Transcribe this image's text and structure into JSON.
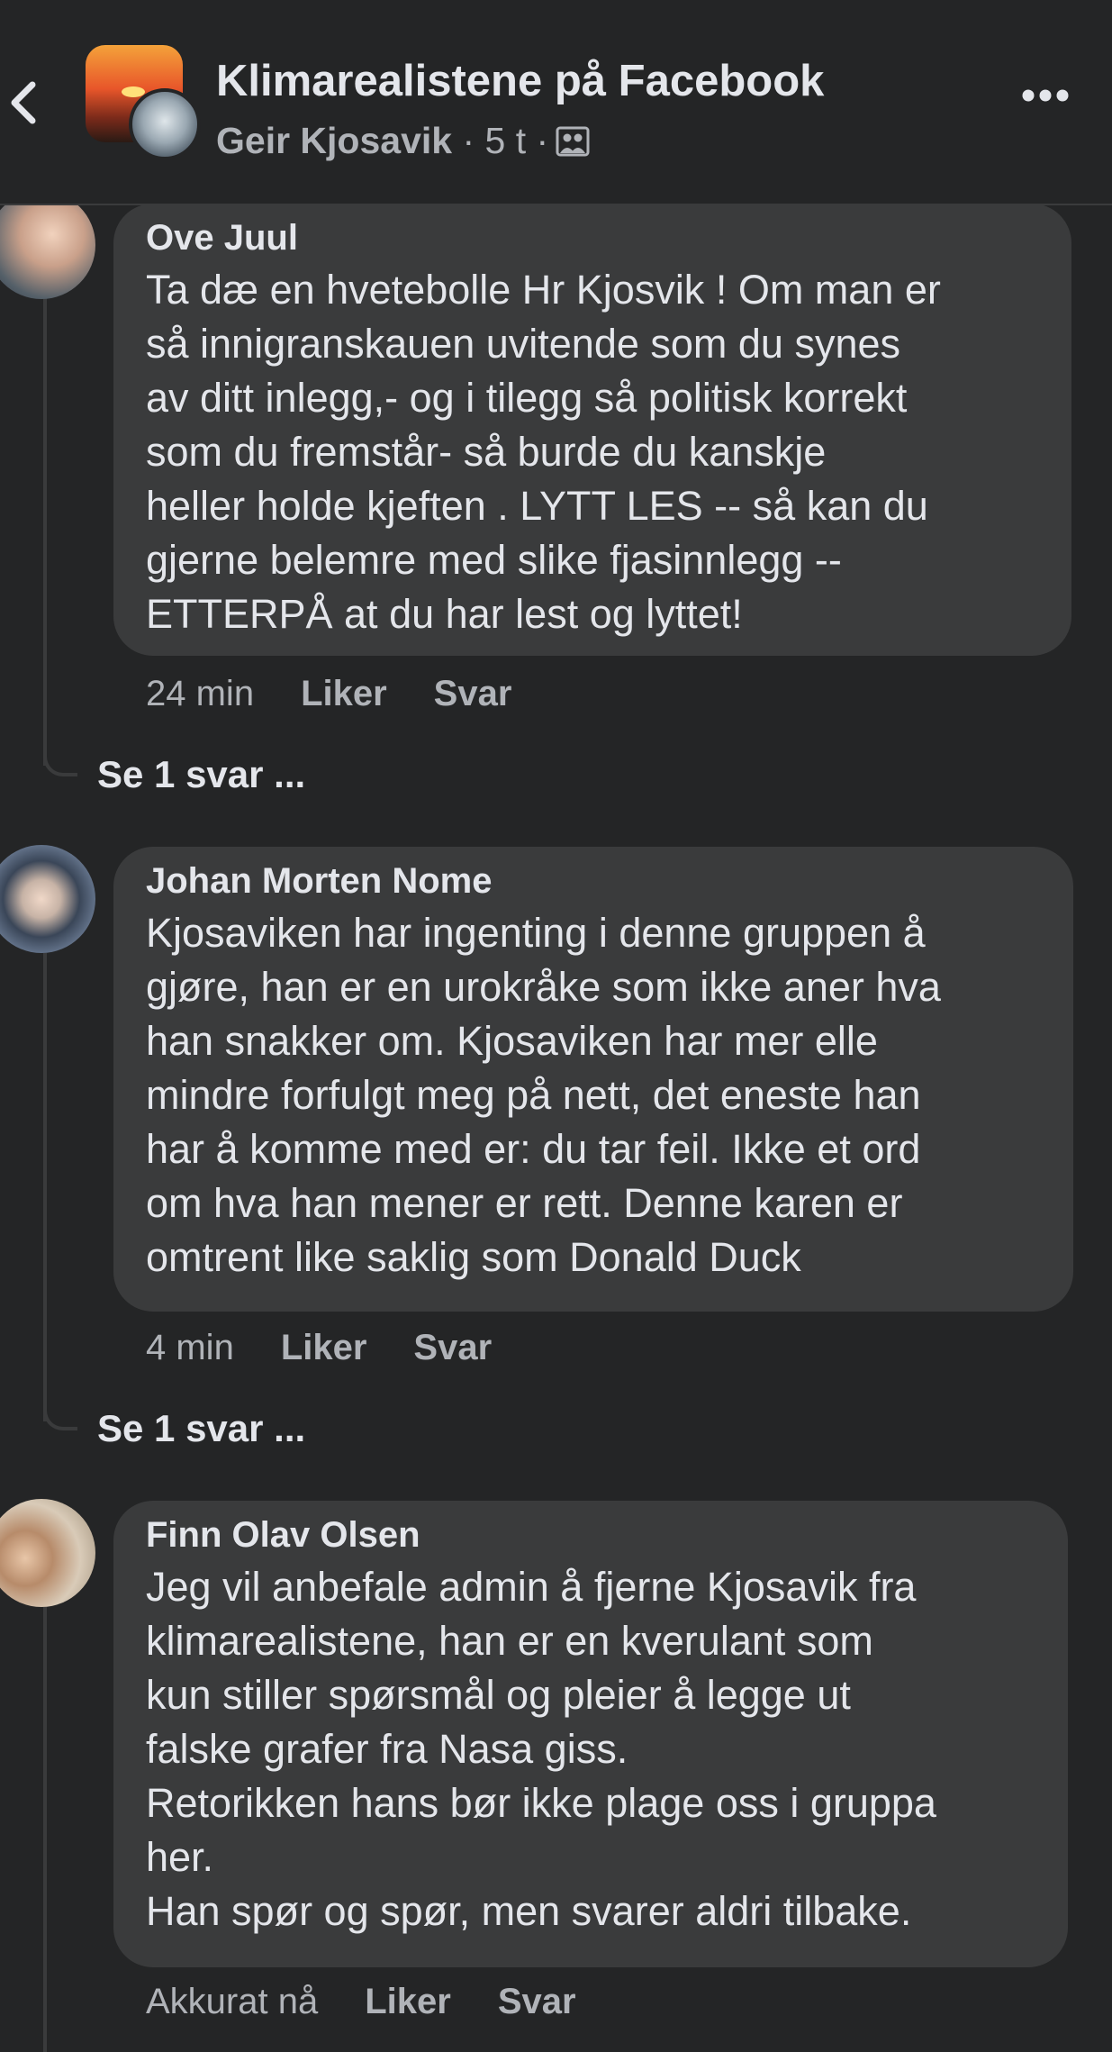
{
  "header": {
    "title": "Klimarealistene på Facebook",
    "poster": "Geir Kjosavik",
    "separator1": "·",
    "time": "5 t",
    "separator2": "·",
    "icons": {
      "back": "chevron-left-icon",
      "more": "more-dots-icon",
      "group": "group-icon"
    }
  },
  "comments": [
    {
      "author": "Ove Juul",
      "lines": [
        "Ta dæ en hvetebolle Hr Kjosvik ! Om man er",
        "så innigranskauen uvitende som du synes",
        "av ditt inlegg,- og i tilegg så politisk korrekt",
        "som du fremstår- så burde du kanskje",
        "heller holde kjeften . LYTT LES -- så kan du",
        "gjerne belemre med slike fjasinnlegg --",
        "ETTERPÅ at du har lest og lyttet!"
      ],
      "time": "24 min",
      "like": "Liker",
      "reply": "Svar",
      "see_replies": "Se 1 svar ..."
    },
    {
      "author": "Johan Morten Nome",
      "lines": [
        "Kjosaviken har ingenting i denne gruppen å",
        "gjøre, han er en urokråke som ikke aner hva",
        "han snakker om. Kjosaviken har mer elle",
        "mindre forfulgt meg på nett, det eneste han",
        "har å komme med er: du tar feil. Ikke et ord",
        "om hva han mener er rett. Denne karen er",
        "omtrent like saklig som Donald Duck"
      ],
      "time": "4 min",
      "like": "Liker",
      "reply": "Svar",
      "see_replies": "Se 1 svar ..."
    },
    {
      "author": "Finn Olav Olsen",
      "lines": [
        "Jeg vil anbefale admin å fjerne Kjosavik fra",
        "klimarealistene,  han er en kverulant som",
        "kun stiller spørsmål og  pleier å legge ut",
        "falske grafer fra Nasa giss.",
        "Retorikken hans bør ikke plage oss i gruppa",
        "her.",
        "Han spør og spør,  men svarer aldri tilbake."
      ],
      "time": "Akkurat nå",
      "like": "Liker",
      "reply": "Svar"
    }
  ]
}
